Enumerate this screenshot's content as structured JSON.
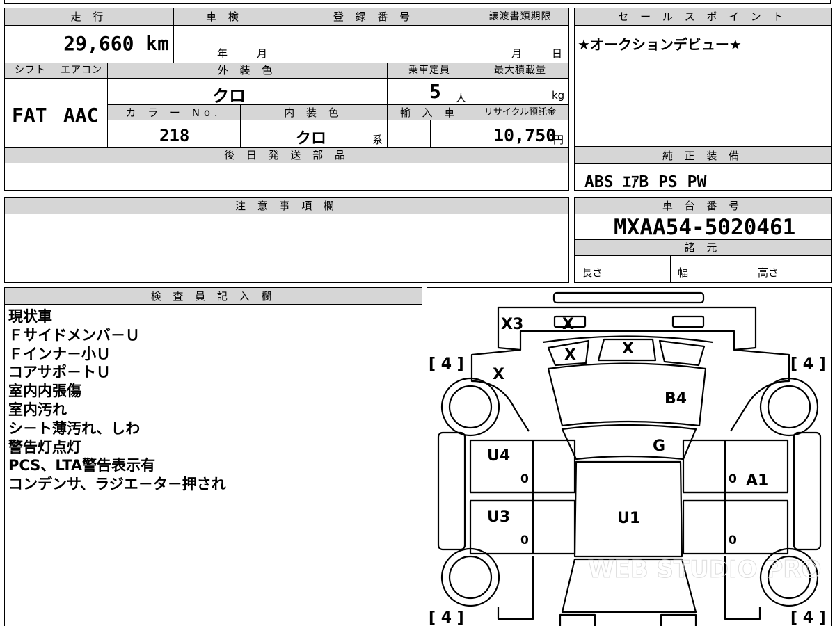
{
  "mileage": {
    "label": "走 行",
    "value": "29,660 km"
  },
  "inspection": {
    "label": "車 検",
    "year": "年",
    "month": "月"
  },
  "registration": {
    "label": "登 録 番 号",
    "value": ""
  },
  "transfer_deadline": {
    "label": "譲渡書類期限",
    "month": "月",
    "day": "日"
  },
  "shift": {
    "label": "シフト",
    "value": "FAT"
  },
  "aircon": {
    "label": "エアコン",
    "value": "AAC"
  },
  "exterior_color": {
    "label": "外 装 色",
    "value": "クロ"
  },
  "capacity": {
    "label": "乗車定員",
    "value": "5",
    "unit": "人"
  },
  "max_load": {
    "label": "最大積載量",
    "unit": "kg"
  },
  "color_no": {
    "label": "カ ラ ー No.",
    "value": "218"
  },
  "interior_color": {
    "label": "内 装 色",
    "value": "クロ",
    "suffix": "系"
  },
  "import": {
    "label": "輸 入 車"
  },
  "recycle": {
    "label": "リサイクル預託金",
    "value": "10,750",
    "unit": "円"
  },
  "later_parts": {
    "label": "後 日 発 送 部 品"
  },
  "sales_point": {
    "label": "セ ー ル ス ポ イ ン ト",
    "text": "★オークションデビュー★"
  },
  "equipment": {
    "label": "純 正 装 備",
    "text": "ABS ｴｱB PS PW"
  },
  "notes": {
    "label": "注 意 事 項 欄"
  },
  "chassis": {
    "label": "車 台 番 号",
    "value": "MXAA54-5020461"
  },
  "specs": {
    "label": "諸 元",
    "length": "長さ",
    "width": "幅",
    "height": "高さ"
  },
  "inspector": {
    "label": "検 査 員 記 入 欄",
    "lines": [
      "現状車",
      "Ｆサイドメンバ－Ｕ",
      "Ｆインナ－小Ｕ",
      "コアサポ－トＵ",
      "室内内張傷",
      "室内汚れ",
      "シ－ト薄汚れ、しわ",
      "警告灯点灯",
      "PCS、LTA警告表示有",
      "コンデンサ、ラジエ－タ－押され"
    ]
  },
  "diagram": {
    "marks": {
      "x3": "X3",
      "x_top": "X",
      "x_ws_left": "X",
      "x_ws_right": "X",
      "x_fender": "X",
      "b4": "B4",
      "g": "G",
      "u4": "U4",
      "u3": "U3",
      "u1": "U1",
      "a1": "A1",
      "zero_ul": "0",
      "zero_ll": "0",
      "zero_ur": "0",
      "zero_lr": "0"
    },
    "tires": {
      "fl": "[ 4 ]",
      "fr": "[ 4 ]",
      "rl": "[ 4 ]",
      "rr": "[ 4 ]"
    },
    "watermark": "WEB STUDIO PRO"
  }
}
